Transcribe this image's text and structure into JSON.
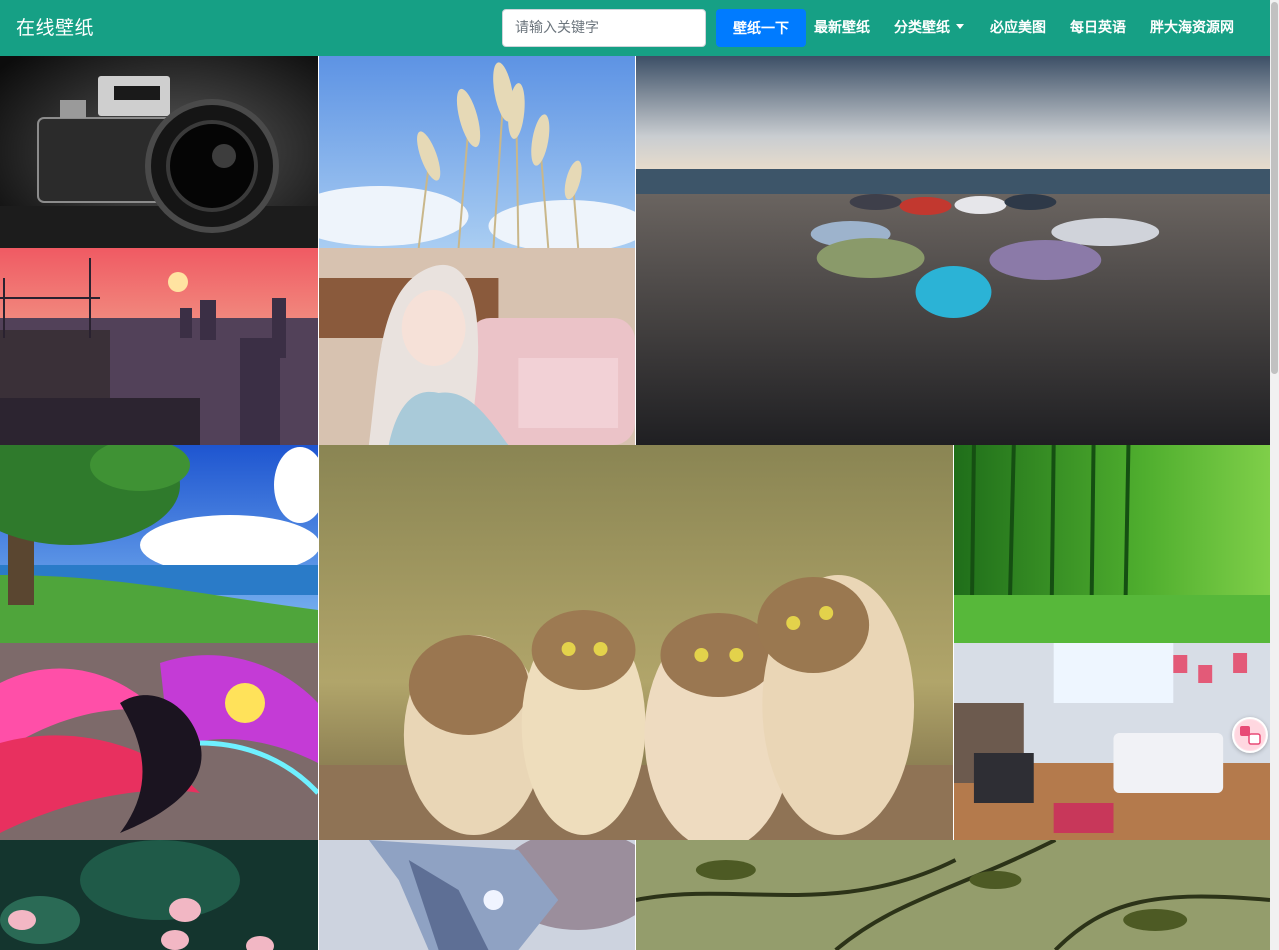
{
  "navbar": {
    "brand": "在线壁纸",
    "search": {
      "placeholder": "请输入关键字",
      "value": ""
    },
    "search_button": "壁纸一下",
    "links": [
      {
        "label": "最新壁纸"
      },
      {
        "label": "分类壁纸",
        "has_dropdown": true
      },
      {
        "label": "必应美图"
      },
      {
        "label": "每日英语"
      },
      {
        "label": "胖大海资源网"
      }
    ]
  },
  "colors": {
    "navbar_bg": "#16a085",
    "button_bg": "#007bff",
    "text": "#ffffff"
  },
  "gallery": {
    "tiles": [
      {
        "subject": "camera"
      },
      {
        "subject": "pampas-grass"
      },
      {
        "subject": "cars-on-beach"
      },
      {
        "subject": "sunset-city"
      },
      {
        "subject": "anime-girl"
      },
      {
        "subject": "tree-seaside"
      },
      {
        "subject": "owls"
      },
      {
        "subject": "bamboo-forest"
      },
      {
        "subject": "abstract-dragon"
      },
      {
        "subject": "anime-room"
      },
      {
        "subject": "lotus"
      },
      {
        "subject": "mecha"
      },
      {
        "subject": "leaves"
      }
    ]
  },
  "floating_widget": {
    "icon": "translate-icon"
  }
}
